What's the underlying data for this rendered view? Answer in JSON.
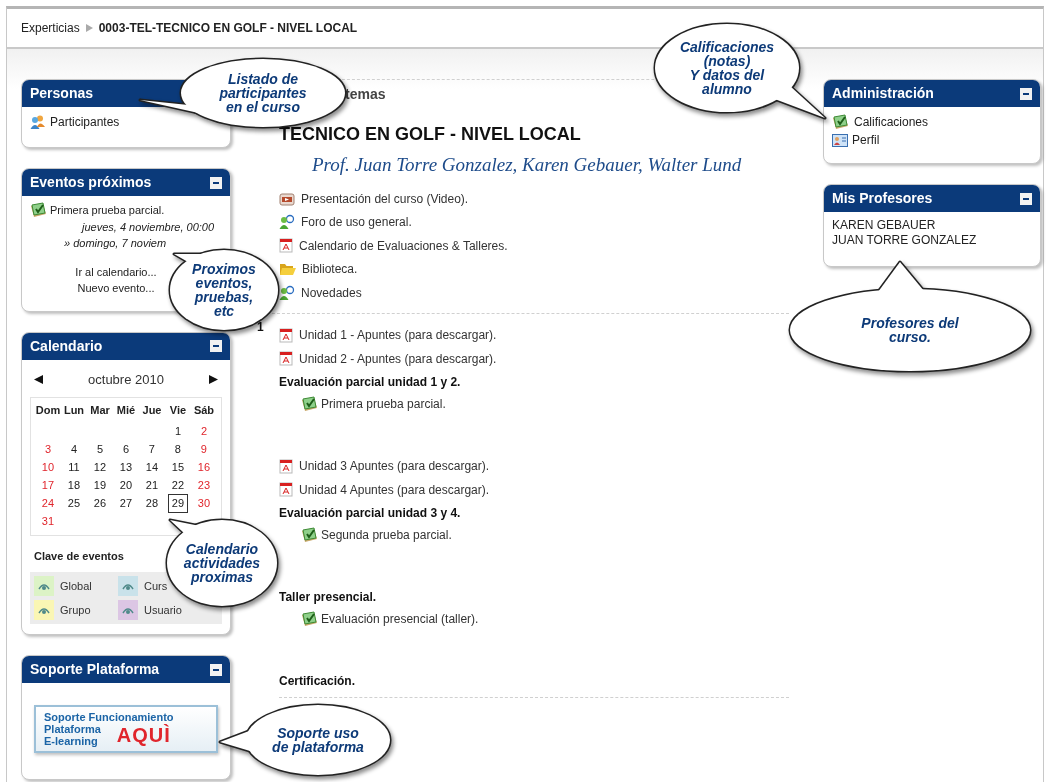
{
  "breadcrumb": [
    {
      "label": "Experticias",
      "bold": false
    },
    {
      "label": "0003-TEL-TECNICO EN GOLF - NIVEL LOCAL",
      "bold": true
    }
  ],
  "left_blocks": [
    {
      "kind": "people",
      "title": "Personas",
      "items": [
        {
          "label": "Participantes"
        }
      ]
    },
    {
      "kind": "events",
      "title": "Eventos próximos",
      "collapsible": true,
      "event": "Primera prueba parcial.",
      "dates": [
        "jueves, 4 noviembre, 00:00",
        "» domingo, 7 noviem"
      ],
      "links": [
        "Ir al calendario...",
        "Nuevo evento..."
      ]
    },
    {
      "kind": "calendar",
      "title": "Calendario",
      "collapsible": true,
      "month": "octubre 2010",
      "weekdays": [
        "Dom",
        "Lun",
        "Mar",
        "Mié",
        "Jue",
        "Vie",
        "Sáb"
      ],
      "weeks": [
        [
          {
            "day": "1",
            "today": false
          },
          {
            "day": "2",
            "today": false
          }
        ],
        [
          {
            "day": "3",
            "today": false
          },
          {
            "day": "4",
            "today": false
          },
          {
            "day": "5",
            "today": false
          },
          {
            "day": "6",
            "today": false
          },
          {
            "day": "7",
            "today": false
          },
          {
            "day": "8",
            "today": false
          },
          {
            "day": "9",
            "today": false
          }
        ],
        [
          {
            "day": "10",
            "today": false
          },
          {
            "day": "11",
            "today": false
          },
          {
            "day": "12",
            "today": false
          },
          {
            "day": "13",
            "today": false
          },
          {
            "day": "14",
            "today": false
          },
          {
            "day": "15",
            "today": false
          },
          {
            "day": "16",
            "today": false
          }
        ],
        [
          {
            "day": "17",
            "today": false
          },
          {
            "day": "18",
            "today": false
          },
          {
            "day": "19",
            "today": false
          },
          {
            "day": "20",
            "today": false
          },
          {
            "day": "21",
            "today": false
          },
          {
            "day": "22",
            "today": false
          },
          {
            "day": "23",
            "today": false
          }
        ],
        [
          {
            "day": "24",
            "today": false
          },
          {
            "day": "25",
            "today": false
          },
          {
            "day": "26",
            "today": false
          },
          {
            "day": "27",
            "today": false
          },
          {
            "day": "28",
            "today": false
          },
          {
            "day": "29",
            "today": true
          },
          {
            "day": "30",
            "today": false
          }
        ],
        [
          {
            "day": "31",
            "today": false
          }
        ]
      ],
      "legend_title": "Clave de eventos",
      "legend": [
        {
          "label": "Global",
          "color": "#dcf3c6"
        },
        {
          "label": "Curs",
          "color": "#c9e2ea"
        },
        {
          "label": "Grupo",
          "color": "#faf6b4"
        },
        {
          "label": "Usuario",
          "color": "#dcc6e4"
        }
      ]
    },
    {
      "kind": "support",
      "title": "Soporte Plataforma",
      "collapsible": true,
      "banner_lines": [
        "Soporte Funcionamiento",
        "Plataforma",
        "E-learning"
      ],
      "banner_action": "AQUÌ"
    }
  ],
  "center": {
    "topic_heading": "temas",
    "course_title": "TECNICO EN GOLF - NIVEL LOCAL",
    "teachers_line": "Prof. Juan Torre Gonzalez, Karen Gebauer, Walter Lund",
    "intro_items": [
      {
        "kind": "video",
        "label": "Presentación del curso (Video)."
      },
      {
        "kind": "forum",
        "label": "Foro de uso general."
      },
      {
        "kind": "pdf",
        "label": "Calendario de Evaluaciones & Talleres."
      },
      {
        "kind": "folder",
        "label": "Biblioteca."
      },
      {
        "kind": "forum",
        "label": "Novedades"
      }
    ],
    "section_number": "1",
    "section_items": [
      {
        "kind": "pdf",
        "label": "Unidad 1 - Apuntes (para descargar)."
      },
      {
        "kind": "pdf",
        "label": "Unidad 2 - Apuntes (para descargar)."
      },
      {
        "kind": "heading",
        "label": "Evaluación parcial unidad 1 y 2."
      },
      {
        "kind": "quiz",
        "label": "Primera prueba parcial."
      },
      {
        "kind": "spacer"
      },
      {
        "kind": "pdf",
        "label": "Unidad 3 Apuntes (para descargar)."
      },
      {
        "kind": "pdf",
        "label": "Unidad 4 Apuntes (para descargar)."
      },
      {
        "kind": "heading",
        "label": "Evaluación parcial unidad 3 y 4."
      },
      {
        "kind": "quiz",
        "label": "Segunda prueba parcial."
      },
      {
        "kind": "spacer"
      },
      {
        "kind": "heading",
        "label": "Taller presencial."
      },
      {
        "kind": "quiz",
        "label": "Evaluación presencial (taller)."
      },
      {
        "kind": "spacer"
      },
      {
        "kind": "heading",
        "label": "Certificación."
      }
    ]
  },
  "right_blocks": [
    {
      "kind": "admin",
      "title": "Administración",
      "collapsible": true,
      "items": [
        {
          "kind": "grades",
          "label": "Calificaciones"
        },
        {
          "kind": "profile",
          "label": "Perfil"
        }
      ]
    },
    {
      "kind": "teachers",
      "title": "Mis Profesores",
      "collapsible": true,
      "names": [
        "KAREN GEBAUER",
        "JUAN TORRE GONZALEZ"
      ]
    }
  ],
  "callouts": [
    {
      "lines": [
        "Listado de",
        "participantes",
        "en el curso"
      ]
    },
    {
      "lines": [
        "Calificaciones",
        "(notas)",
        "Y datos del",
        "alumno"
      ]
    },
    {
      "lines": [
        "Proximos",
        "eventos,",
        "pruebas,",
        "etc"
      ]
    },
    {
      "lines": [
        "Calendario",
        "actividades",
        "proximas"
      ]
    },
    {
      "lines": [
        "Profesores del",
        "curso."
      ]
    },
    {
      "lines": [
        "Soporte uso",
        "de plataforma"
      ]
    }
  ]
}
